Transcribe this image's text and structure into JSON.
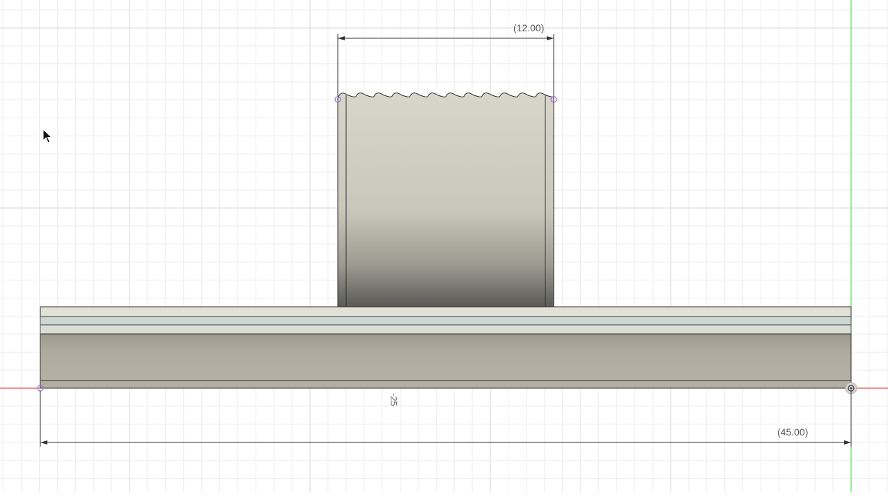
{
  "sketch": {
    "dimensions": {
      "top_width": "(12.00)",
      "bottom_width": "(45.00)",
      "vertical_label": "-25"
    },
    "colors": {
      "background": "#ffffff",
      "grid_minor": "#eeeeee",
      "grid_major": "#dcdcdc",
      "x_axis": "#d22b2b",
      "y_axis": "#3ad13a",
      "body_light": "#d6d4c8",
      "body_mid": "#b8b5a8",
      "body_dark": "#5a5a58",
      "base_face": "#aeaa9d",
      "base_strip_light": "#e2e1d6",
      "base_strip_blue": "#cfd8d6",
      "edge": "#2d2d2d",
      "sketch_point": "#9b6fd6",
      "dim_line": "#333333"
    }
  }
}
